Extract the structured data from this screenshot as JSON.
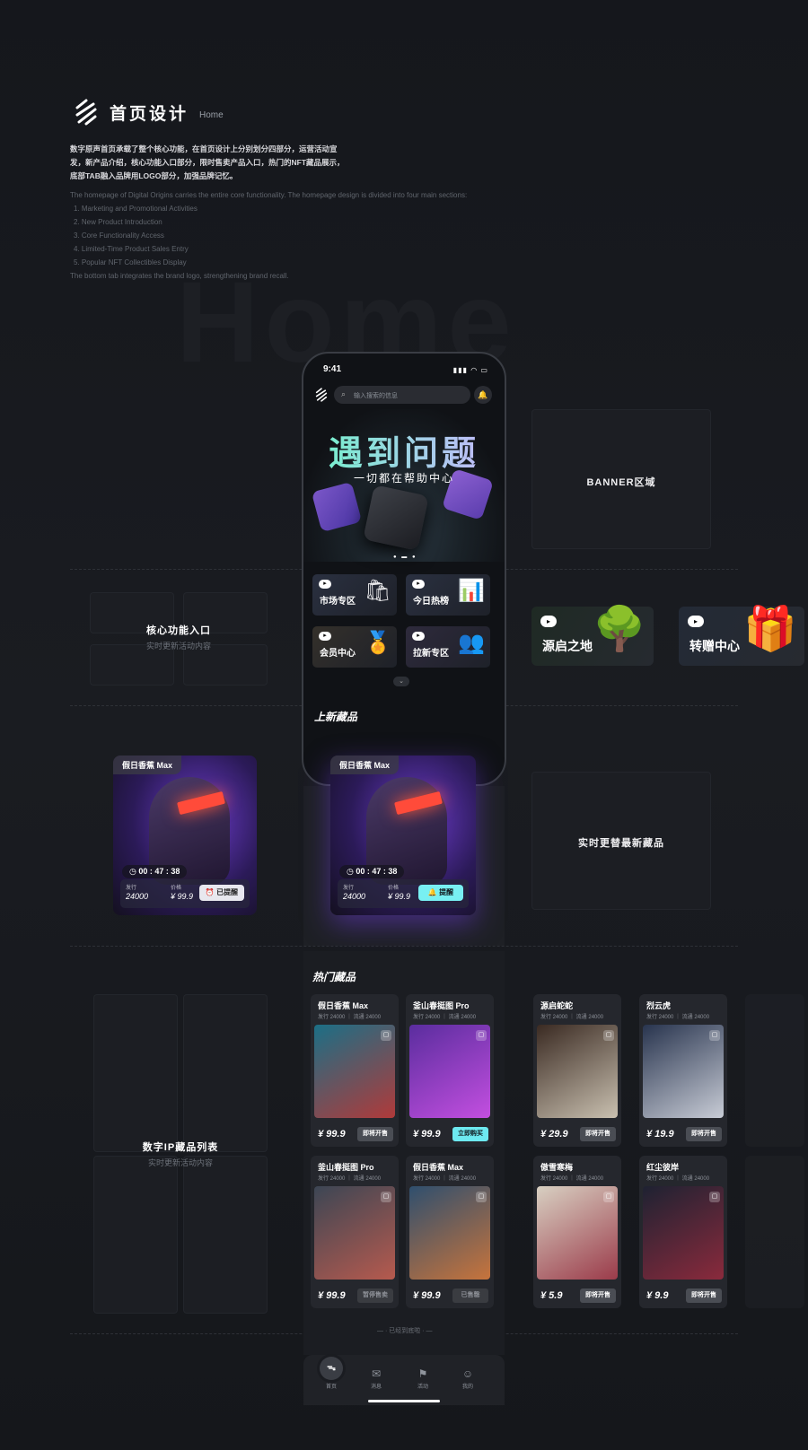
{
  "header": {
    "title": "首页设计",
    "subtitle": "Home",
    "desc_cn": "数字原声首页承载了整个核心功能，在首页设计上分别划分四部分，运营活动宣发，新产品介绍，核心功能入口部分，限时售卖产品入口，热门的NFT藏品展示，底部TAB融入品牌用LOGO部分，加强品牌记忆。",
    "desc_en": [
      "The homepage of Digital Origins carries the entire core functionality. The homepage design is divided into four main sections:",
      "1. Marketing and Promotional Activities",
      "2. New Product Introduction",
      "3. Core Functionality Access",
      "4. Limited-Time Product Sales Entry",
      "5. Popular NFT Collectibles Display",
      "The bottom tab integrates the brand logo, strengthening brand recall."
    ],
    "bg_word": "Home"
  },
  "labels": {
    "banner_area": "BANNER区域",
    "core_entry": "核心功能入口",
    "core_entry_sub": "实时更新活动内容",
    "realtime_new": "实时更替最新藏品",
    "ip_list": "数字IP藏品列表",
    "ip_list_sub": "实时更新活动内容"
  },
  "phone": {
    "time": "9:41",
    "status": "▮▮▮ ◠ ▭",
    "search_placeholder": "输入搜索的信息",
    "banner_title": "遇到问题",
    "banner_sub": "一切都在帮助中心",
    "quick": [
      {
        "label": "市场专区",
        "icon": "shopping-bag-icon",
        "glyph": "🛍"
      },
      {
        "label": "今日热榜",
        "icon": "chart-icon",
        "glyph": "📊"
      },
      {
        "label": "会员中心",
        "icon": "vip-badge-icon",
        "glyph": "🏅"
      },
      {
        "label": "拉新专区",
        "icon": "users-icon",
        "glyph": "👥"
      }
    ],
    "new_title": "上新藏品"
  },
  "side_quick": [
    {
      "label": "源启之地",
      "glyph": "🌳"
    },
    {
      "label": "转赠中心",
      "glyph": "🎁"
    }
  ],
  "feature": {
    "tag": "假日香蕉 Max",
    "timer": "00 : 47 : 38",
    "issue_label": "发行",
    "issue": "24000",
    "price_label": "价格",
    "price": "¥ 99.9",
    "btn_reminded": "已提醒",
    "btn_remind": "提醒"
  },
  "hot": {
    "title": "热门藏品",
    "end_text": "— · 已经到底啦 · —",
    "items": [
      {
        "name": "假日香蕉 Max",
        "meta": "发行 24000 ｜ 流通 24000",
        "price": "¥ 99.9",
        "btn": "即将开售",
        "style": "dark",
        "c1": "#1b6f86",
        "c2": "#b03a3a"
      },
      {
        "name": "釜山春挺图 Pro",
        "meta": "发行 24000 ｜ 流通 24000",
        "price": "¥ 99.9",
        "btn": "立即购买",
        "style": "cyan",
        "c1": "#5a2d9e",
        "c2": "#c34fe0"
      },
      {
        "name": "源启蛇蛇",
        "meta": "发行 24000 ｜ 流通 24000",
        "price": "¥ 29.9",
        "btn": "即将开售",
        "style": "dark",
        "c1": "#3a2a22",
        "c2": "#c9c0b0"
      },
      {
        "name": "烈云虎",
        "meta": "发行 24000 ｜ 流通 24000",
        "price": "¥ 19.9",
        "btn": "即将开售",
        "style": "dark",
        "c1": "#28344e",
        "c2": "#c8ccd6"
      },
      {
        "name": "釜山春挺图 Pro",
        "meta": "发行 24000 ｜ 流通 24000",
        "price": "¥ 99.9",
        "btn": "暂停售卖",
        "style": "mute",
        "c1": "#3c4654",
        "c2": "#b65a4e"
      },
      {
        "name": "假日香蕉 Max",
        "meta": "发行 24000 ｜ 流通 24000",
        "price": "¥ 99.9",
        "btn": "已售罄",
        "style": "mute",
        "c1": "#2f4f6e",
        "c2": "#c7743c"
      },
      {
        "name": "傲雪寒梅",
        "meta": "发行 24000 ｜ 流通 24000",
        "price": "¥ 5.9",
        "btn": "即将开售",
        "style": "dark",
        "c1": "#d8d0c2",
        "c2": "#9b3b4a"
      },
      {
        "name": "红尘彼岸",
        "meta": "发行 24000 ｜ 流通 24000",
        "price": "¥ 9.9",
        "btn": "即将开售",
        "style": "dark",
        "c1": "#1e2232",
        "c2": "#8a2a3c"
      }
    ]
  },
  "tabs": [
    {
      "label": "首页",
      "glyph": "⌂"
    },
    {
      "label": "消息",
      "glyph": "✉"
    },
    {
      "label": "活动",
      "glyph": "⚑"
    },
    {
      "label": "我的",
      "glyph": "☺"
    }
  ]
}
